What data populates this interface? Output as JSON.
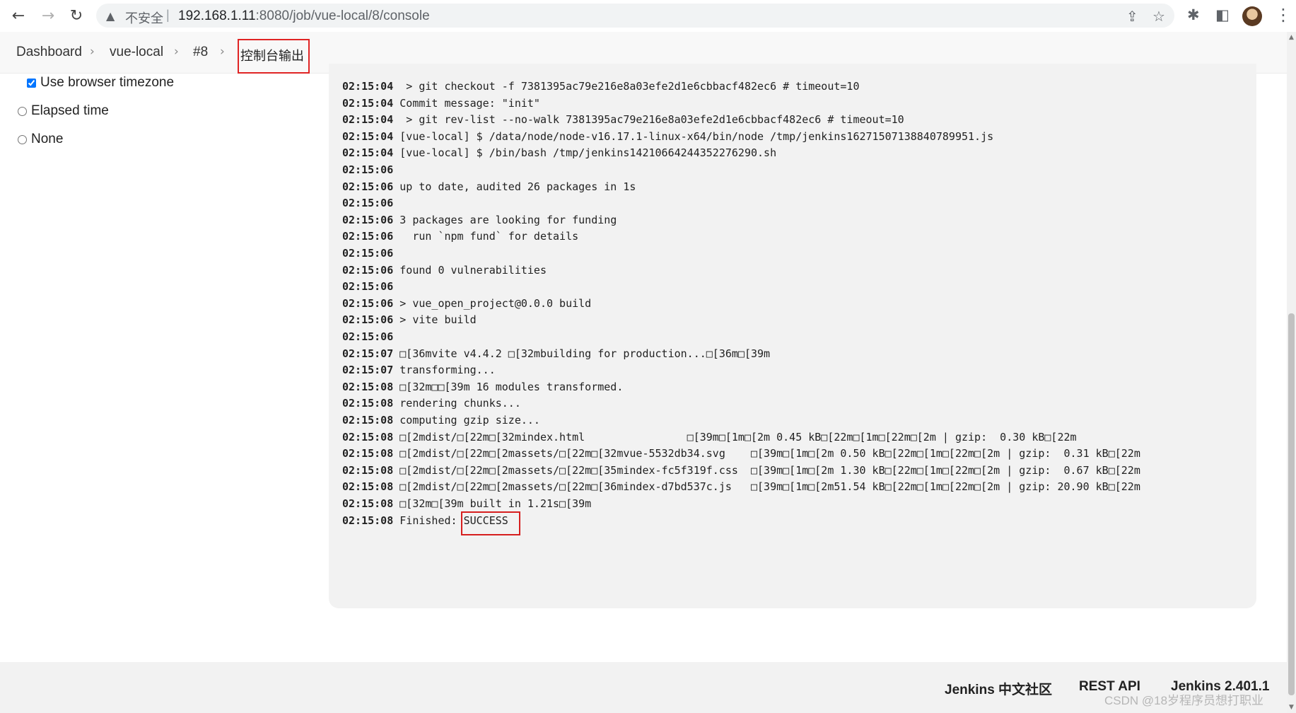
{
  "browser": {
    "insecure_label": "不安全",
    "separator": "|",
    "url_host": "192.168.1.11",
    "url_rest": ":8080/job/vue-local/8/console",
    "icons": [
      "back-icon",
      "forward-icon",
      "reload-icon",
      "warning-icon",
      "share-icon",
      "star-icon",
      "extensions-icon",
      "sidepanel-icon",
      "profile-avatar",
      "menu-icon"
    ]
  },
  "breadcrumb": {
    "items": [
      "Dashboard",
      "vue-local",
      "#8"
    ],
    "current": "控制台输出"
  },
  "timestamp_options": {
    "use_browser_tz": "Use browser timezone",
    "elapsed": "Elapsed time",
    "none": "None"
  },
  "console": {
    "lines": [
      {
        "ts": "02:15:04",
        "text": " > git checkout -f 7381395ac79e216e8a03efe2d1e6cbbacf482ec6 # timeout=10"
      },
      {
        "ts": "02:15:04",
        "text": "Commit message: \"init\""
      },
      {
        "ts": "02:15:04",
        "text": " > git rev-list --no-walk 7381395ac79e216e8a03efe2d1e6cbbacf482ec6 # timeout=10"
      },
      {
        "ts": "02:15:04",
        "text": "[vue-local] $ /data/node/node-v16.17.1-linux-x64/bin/node /tmp/jenkins16271507138840789951.js"
      },
      {
        "ts": "02:15:04",
        "text": "[vue-local] $ /bin/bash /tmp/jenkins14210664244352276290.sh"
      },
      {
        "ts": "02:15:06",
        "text": ""
      },
      {
        "ts": "02:15:06",
        "text": "up to date, audited 26 packages in 1s"
      },
      {
        "ts": "02:15:06",
        "text": ""
      },
      {
        "ts": "02:15:06",
        "text": "3 packages are looking for funding"
      },
      {
        "ts": "02:15:06",
        "text": "  run `npm fund` for details"
      },
      {
        "ts": "02:15:06",
        "text": ""
      },
      {
        "ts": "02:15:06",
        "text": "found 0 vulnerabilities"
      },
      {
        "ts": "02:15:06",
        "text": ""
      },
      {
        "ts": "02:15:06",
        "text": "> vue_open_project@0.0.0 build"
      },
      {
        "ts": "02:15:06",
        "text": "> vite build"
      },
      {
        "ts": "02:15:06",
        "text": ""
      },
      {
        "ts": "02:15:07",
        "text": "\u001b[36mvite v4.4.2 \u001b[32mbuilding for production...\u001b[36m\u001b[39m"
      },
      {
        "ts": "02:15:07",
        "text": "transforming..."
      },
      {
        "ts": "02:15:08",
        "text": "\u001b[32m\u001b\u001b[39m 16 modules transformed."
      },
      {
        "ts": "02:15:08",
        "text": "rendering chunks..."
      },
      {
        "ts": "02:15:08",
        "text": "computing gzip size..."
      },
      {
        "ts": "02:15:08",
        "text": "\u001b[2mdist/\u001b[22m\u001b[32mindex.html                \u001b[39m\u001b[1m\u001b[2m 0.45 kB\u001b[22m\u001b[1m\u001b[22m\u001b[2m | gzip:  0.30 kB\u001b[22m"
      },
      {
        "ts": "02:15:08",
        "text": "\u001b[2mdist/\u001b[22m\u001b[2massets/\u001b[22m\u001b[32mvue-5532db34.svg    \u001b[39m\u001b[1m\u001b[2m 0.50 kB\u001b[22m\u001b[1m\u001b[22m\u001b[2m | gzip:  0.31 kB\u001b[22m"
      },
      {
        "ts": "02:15:08",
        "text": "\u001b[2mdist/\u001b[22m\u001b[2massets/\u001b[22m\u001b[35mindex-fc5f319f.css  \u001b[39m\u001b[1m\u001b[2m 1.30 kB\u001b[22m\u001b[1m\u001b[22m\u001b[2m | gzip:  0.67 kB\u001b[22m"
      },
      {
        "ts": "02:15:08",
        "text": "\u001b[2mdist/\u001b[22m\u001b[2massets/\u001b[22m\u001b[36mindex-d7bd537c.js   \u001b[39m\u001b[1m\u001b[2m51.54 kB\u001b[22m\u001b[1m\u001b[22m\u001b[2m | gzip: 20.90 kB\u001b[22m"
      },
      {
        "ts": "02:15:08",
        "text": "\u001b[32m\u001b[39m built in 1.21s\u001b[39m"
      },
      {
        "ts": "02:15:08",
        "text": "Finished: SUCCESS"
      }
    ]
  },
  "footer": {
    "community": "Jenkins 中文社区",
    "rest_api": "REST API",
    "version": "Jenkins 2.401.1"
  },
  "watermark": "CSDN @18岁程序员想打职业"
}
